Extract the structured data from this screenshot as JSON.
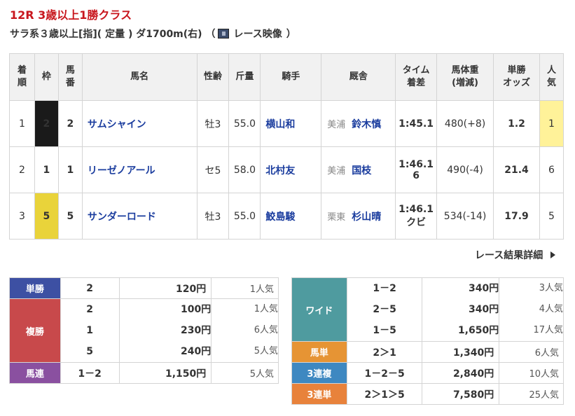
{
  "race": {
    "title": "12R 3歳以上1勝クラス",
    "sub_text": "サラ系３歳以上[指]( 定量 ) ダ1700m(右) （",
    "video_label": "レース映像",
    "sub_close": "）"
  },
  "result_table": {
    "headers": {
      "rank": [
        "着",
        "順"
      ],
      "waku": "枠",
      "umaban": [
        "馬",
        "番"
      ],
      "horse": "馬名",
      "sexage": "性齢",
      "weight": "斤量",
      "jockey": "騎手",
      "trainer": "厩舎",
      "time": [
        "タイム",
        "着差"
      ],
      "body": [
        "馬体重",
        "(増減)"
      ],
      "odds": [
        "単勝",
        "オッズ"
      ],
      "pop": [
        "人",
        "気"
      ]
    },
    "rows": [
      {
        "rank": "1",
        "waku": "2",
        "umaban": "2",
        "horse": "サムシャイン",
        "sexage": "牡3",
        "weight": "55.0",
        "jockey": "横山和",
        "region": "美浦",
        "trainer": "鈴木慎",
        "time": [
          "1:45.1"
        ],
        "body": "480(+8)",
        "odds": "1.2",
        "pop": "1"
      },
      {
        "rank": "2",
        "waku": "1",
        "umaban": "1",
        "horse": "リーゼノアール",
        "sexage": "セ5",
        "weight": "58.0",
        "jockey": "北村友",
        "region": "美浦",
        "trainer": "国枝",
        "time": [
          "1:46.1",
          "6"
        ],
        "body": "490(-4)",
        "odds": "21.4",
        "pop": "6"
      },
      {
        "rank": "3",
        "waku": "5",
        "umaban": "5",
        "horse": "サンダーロード",
        "sexage": "牡3",
        "weight": "55.0",
        "jockey": "鮫島駿",
        "region": "栗東",
        "trainer": "杉山晴",
        "time": [
          "1:46.1",
          "クビ"
        ],
        "body": "534(-14)",
        "odds": "17.9",
        "pop": "5"
      }
    ]
  },
  "detail_link": "レース結果詳細",
  "payouts_left": {
    "tansho": {
      "label": "単勝",
      "combo": "2",
      "amount": "120円",
      "ninki": "1人気"
    },
    "fukusho": {
      "label": "複勝",
      "combos": [
        "2",
        "1",
        "5"
      ],
      "amounts": [
        "100円",
        "230円",
        "240円"
      ],
      "ninki": [
        "1人気",
        "6人気",
        "5人気"
      ]
    },
    "umaren": {
      "label": "馬連",
      "combo": "1－2",
      "amount": "1,150円",
      "ninki": "5人気"
    }
  },
  "payouts_right": {
    "wide": {
      "label": "ワイド",
      "combos": [
        "1－2",
        "2－5",
        "1－5"
      ],
      "amounts": [
        "340円",
        "340円",
        "1,650円"
      ],
      "ninki": [
        "3人気",
        "4人気",
        "17人気"
      ]
    },
    "umatan": {
      "label": "馬単",
      "combo": "2＞1",
      "amount": "1,340円",
      "ninki": "6人気"
    },
    "sanrenpuku": {
      "label": "3連複",
      "combo": "1－2－5",
      "amount": "2,840円",
      "ninki": "10人気"
    },
    "sanrentan": {
      "label": "3連単",
      "combo": "2＞1＞5",
      "amount": "7,580円",
      "ninki": "25人気"
    }
  },
  "colors": {
    "title_red": "#c8161d",
    "tansho": "#3d50a3",
    "fukusho": "#c8494b",
    "umaren": "#8a50a0",
    "wide": "#4f9b9f",
    "umatan": "#e69434",
    "sanrenpuku": "#3e88c1",
    "sanrentan": "#e8823b"
  },
  "icons": {
    "video": "video-icon",
    "detail": "chevron-right-icon"
  }
}
